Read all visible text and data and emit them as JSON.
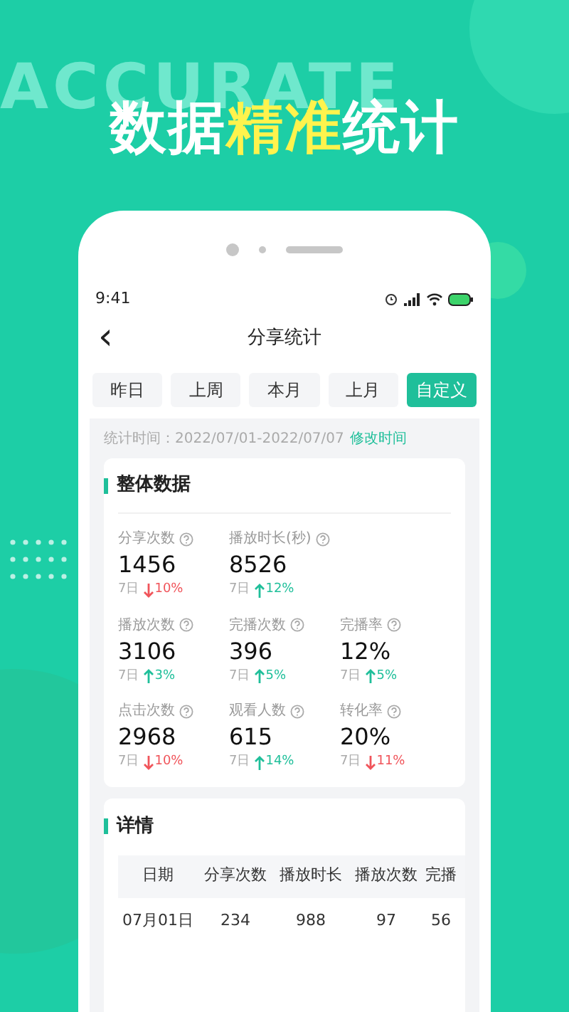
{
  "backdrop_text": "ACCURATE",
  "headline": [
    {
      "text": "数据",
      "highlight": false
    },
    {
      "text": "精准",
      "highlight": true
    },
    {
      "text": "统计",
      "highlight": false
    }
  ],
  "status_bar": {
    "time": "9:41"
  },
  "nav": {
    "back": "‹",
    "title": "分享统计"
  },
  "tabs": [
    {
      "label": "昨日",
      "selected": false
    },
    {
      "label": "上周",
      "selected": false
    },
    {
      "label": "本月",
      "selected": false
    },
    {
      "label": "上月",
      "selected": false
    },
    {
      "label": "自定义",
      "selected": true
    }
  ],
  "period": {
    "label": "统计时间：2022/07/01-2022/07/07",
    "link": "修改时间"
  },
  "overview": {
    "title": "整体数据",
    "rows": [
      [
        {
          "label": "分享次数",
          "value": "1456",
          "period": "7日",
          "kind": "down",
          "change": "10%"
        },
        {
          "label": "播放时长(秒)",
          "value": "8526",
          "period": "7日",
          "kind": "up",
          "change": "12%"
        }
      ],
      [
        {
          "label": "播放次数",
          "value": "3106",
          "period": "7日",
          "kind": "up",
          "change": "3%"
        },
        {
          "label": "完播次数",
          "value": "396",
          "period": "7日",
          "kind": "up",
          "change": "5%"
        },
        {
          "label": "完播率",
          "value": "12%",
          "period": "7日",
          "kind": "up",
          "change": "5%"
        }
      ],
      [
        {
          "label": "点击次数",
          "value": "2968",
          "period": "7日",
          "kind": "down",
          "change": "10%"
        },
        {
          "label": "观看人数",
          "value": "615",
          "period": "7日",
          "kind": "up",
          "change": "14%"
        },
        {
          "label": "转化率",
          "value": "20%",
          "period": "7日",
          "kind": "down",
          "change": "11%"
        }
      ]
    ]
  },
  "details": {
    "title": "详情",
    "columns": [
      "日期",
      "分享次数",
      "播放时长",
      "播放次数",
      "完播"
    ],
    "rows": [
      [
        "07月01日",
        "234",
        "988",
        "97",
        "56"
      ]
    ]
  }
}
